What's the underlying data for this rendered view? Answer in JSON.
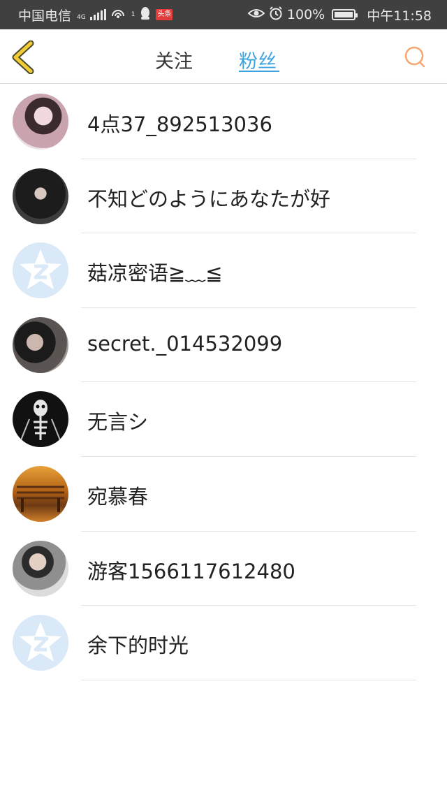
{
  "status_bar": {
    "carrier": "中国电信",
    "network": "4G",
    "hotspot_sup": "1",
    "news_badge": "头条",
    "battery_text": "100%",
    "battery_level": 1.0,
    "time": "中午11:58"
  },
  "header": {
    "tabs": [
      {
        "label": "关注",
        "active": false
      },
      {
        "label": "粉丝",
        "active": true
      }
    ],
    "accent_color": "#3ca3de",
    "back_icon_color": "#f2cc35",
    "search_icon_color": "#f5a571"
  },
  "followers": [
    {
      "name": "4点37_892513036",
      "avatar": "photo"
    },
    {
      "name": "不知どのようにあなたが好",
      "avatar": "photo"
    },
    {
      "name": "菇凉密语≧﹏≦",
      "avatar": "default-qzone-star"
    },
    {
      "name": "secret._014532099",
      "avatar": "photo"
    },
    {
      "name": "无言シ",
      "avatar": "skeleton-photo"
    },
    {
      "name": "宛慕春",
      "avatar": "bench-photo"
    },
    {
      "name": "游客1566117612480",
      "avatar": "photo"
    },
    {
      "name": "余下的时光",
      "avatar": "default-qzone-star"
    }
  ]
}
